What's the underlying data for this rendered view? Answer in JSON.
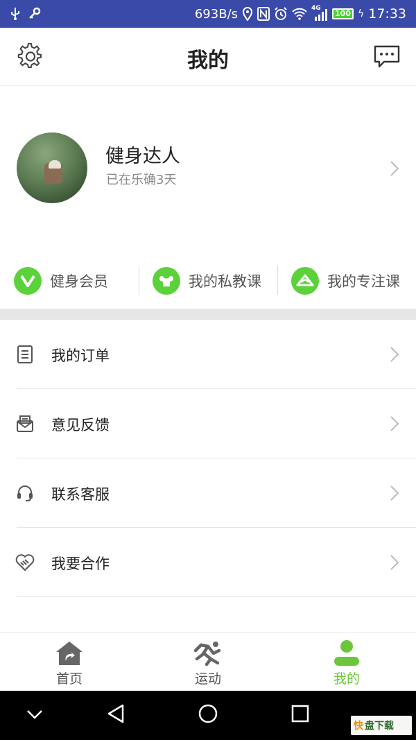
{
  "status_bar": {
    "net_speed": "693B/s",
    "signal_label": "4G",
    "battery": "100",
    "time": "17:33"
  },
  "header": {
    "title": "我的"
  },
  "profile": {
    "name": "健身达人",
    "days_text": "已在乐确3天"
  },
  "quick_links": [
    {
      "label": "健身会员",
      "icon": "v-badge-icon"
    },
    {
      "label": "我的私教课",
      "icon": "muscle-icon"
    },
    {
      "label": "我的专注课",
      "icon": "focus-icon"
    }
  ],
  "menu": [
    {
      "label": "我的订单",
      "icon": "order-list-icon"
    },
    {
      "label": "意见反馈",
      "icon": "feedback-mail-icon"
    },
    {
      "label": "联系客服",
      "icon": "headset-icon"
    },
    {
      "label": "我要合作",
      "icon": "handshake-icon"
    }
  ],
  "tabs": [
    {
      "label": "首页",
      "icon": "home-icon"
    },
    {
      "label": "运动",
      "icon": "run-icon"
    },
    {
      "label": "我的",
      "icon": "person-icon",
      "active": true
    }
  ],
  "colors": {
    "accent_green": "#5bd23a",
    "active_tab": "#6cc53b",
    "status_bar": "#3a4aa8"
  },
  "watermark": {
    "part1": "快",
    "part2": "盘下载"
  }
}
